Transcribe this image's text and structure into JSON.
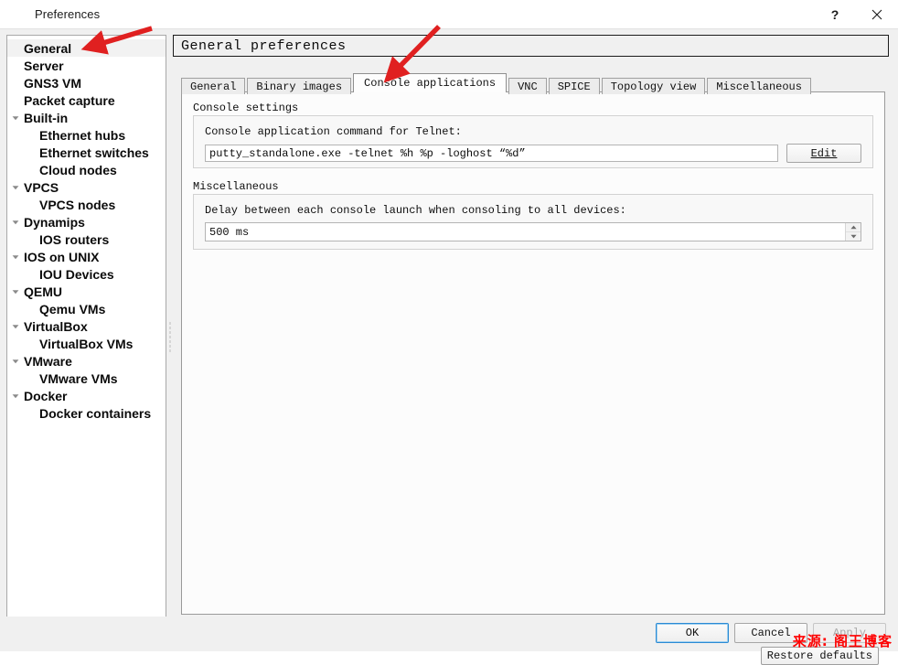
{
  "window": {
    "title": "Preferences",
    "icon": "gns3-logo-icon",
    "help_label": "?",
    "close_label": "×"
  },
  "sidebar": {
    "items": [
      {
        "label": "General",
        "level": 0,
        "expander": "none",
        "selected": true
      },
      {
        "label": "Server",
        "level": 0,
        "expander": "none",
        "selected": false
      },
      {
        "label": "GNS3 VM",
        "level": 0,
        "expander": "none",
        "selected": false
      },
      {
        "label": "Packet capture",
        "level": 0,
        "expander": "none",
        "selected": false
      },
      {
        "label": "Built-in",
        "level": 0,
        "expander": "expanded",
        "selected": false
      },
      {
        "label": "Ethernet hubs",
        "level": 1,
        "expander": "none",
        "selected": false
      },
      {
        "label": "Ethernet switches",
        "level": 1,
        "expander": "none",
        "selected": false
      },
      {
        "label": "Cloud nodes",
        "level": 1,
        "expander": "none",
        "selected": false
      },
      {
        "label": "VPCS",
        "level": 0,
        "expander": "expanded",
        "selected": false
      },
      {
        "label": "VPCS nodes",
        "level": 1,
        "expander": "none",
        "selected": false
      },
      {
        "label": "Dynamips",
        "level": 0,
        "expander": "expanded",
        "selected": false
      },
      {
        "label": "IOS routers",
        "level": 1,
        "expander": "none",
        "selected": false
      },
      {
        "label": "IOS on UNIX",
        "level": 0,
        "expander": "expanded",
        "selected": false
      },
      {
        "label": "IOU Devices",
        "level": 1,
        "expander": "none",
        "selected": false
      },
      {
        "label": "QEMU",
        "level": 0,
        "expander": "expanded",
        "selected": false
      },
      {
        "label": "Qemu VMs",
        "level": 1,
        "expander": "none",
        "selected": false
      },
      {
        "label": "VirtualBox",
        "level": 0,
        "expander": "expanded",
        "selected": false
      },
      {
        "label": "VirtualBox VMs",
        "level": 1,
        "expander": "none",
        "selected": false
      },
      {
        "label": "VMware",
        "level": 0,
        "expander": "expanded",
        "selected": false
      },
      {
        "label": "VMware VMs",
        "level": 1,
        "expander": "none",
        "selected": false
      },
      {
        "label": "Docker",
        "level": 0,
        "expander": "expanded",
        "selected": false
      },
      {
        "label": "Docker containers",
        "level": 1,
        "expander": "none",
        "selected": false
      }
    ]
  },
  "page": {
    "header_title": "General preferences",
    "tabs": [
      {
        "label": "General",
        "active": false
      },
      {
        "label": "Binary images",
        "active": false
      },
      {
        "label": "Console applications",
        "active": true
      },
      {
        "label": "VNC",
        "active": false
      },
      {
        "label": "SPICE",
        "active": false
      },
      {
        "label": "Topology view",
        "active": false
      },
      {
        "label": "Miscellaneous",
        "active": false
      }
    ],
    "console_settings": {
      "group_title": "Console settings",
      "telnet_label": "Console application command for Telnet:",
      "telnet_value": "putty_standalone.exe -telnet %h %p -loghost “%d”",
      "telnet_placeholder": "",
      "edit_button": "Edit"
    },
    "miscellaneous": {
      "group_title": "Miscellaneous",
      "delay_label": "Delay between each console launch when consoling to all devices:",
      "delay_value": "500 ms",
      "delay_placeholder": ""
    },
    "restore_defaults": "Restore defaults"
  },
  "footer": {
    "ok": "OK",
    "cancel": "Cancel",
    "apply": "Apply"
  },
  "annotations": {
    "watermark": "来源: 阁王博客",
    "arrow_color": "#e02020"
  }
}
